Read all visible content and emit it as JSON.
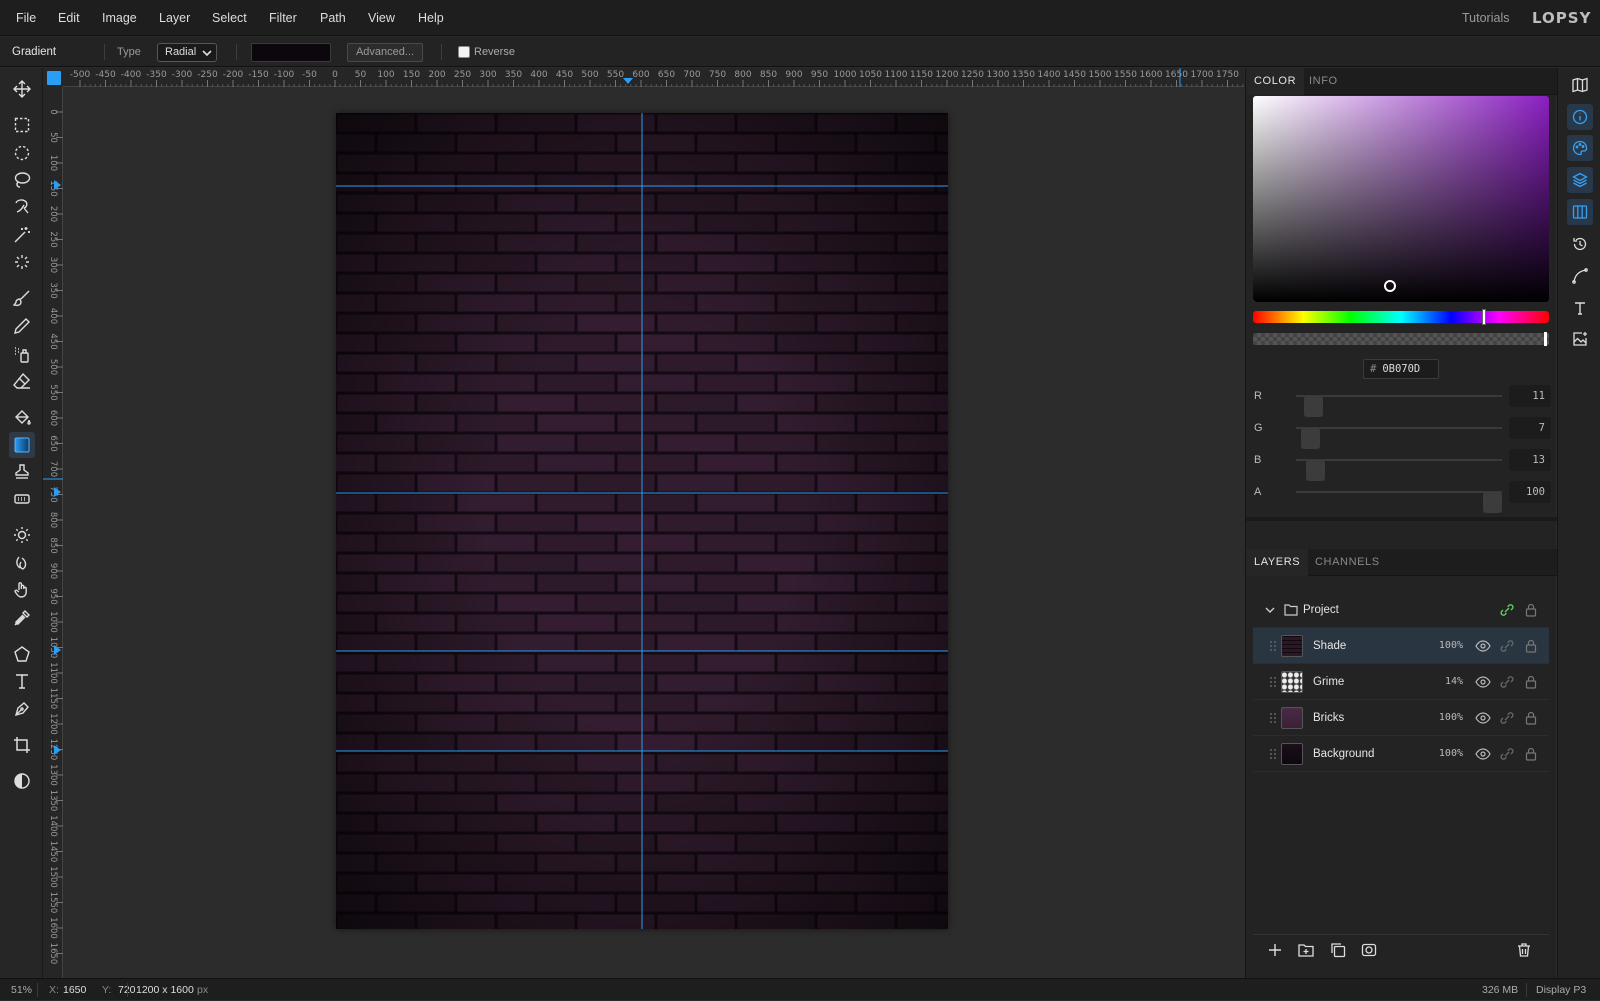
{
  "menubar": {
    "items": [
      "File",
      "Edit",
      "Image",
      "Layer",
      "Select",
      "Filter",
      "Path",
      "View",
      "Help"
    ],
    "tutorials": "Tutorials",
    "logo": "LOPSY"
  },
  "options": {
    "tool_title": "Gradient",
    "type_label": "Type",
    "type_value": "Radial",
    "advanced_label": "Advanced...",
    "reverse_label": "Reverse",
    "reverse_checked": false
  },
  "tools": [
    "move-icon",
    "rect-select-icon",
    "ellipse-select-icon",
    "lasso-icon",
    "quick-select-icon",
    "magic-wand-icon",
    "object-select-icon",
    "brush-icon",
    "pencil-icon",
    "spray-icon",
    "eraser-icon",
    "paint-bucket-icon",
    "gradient-icon",
    "clone-stamp-icon",
    "patch-icon",
    "dodge-icon",
    "burn-icon",
    "smudge-hand-icon",
    "eyedropper-icon",
    "shape-icon",
    "text-icon",
    "pen-icon",
    "crop-icon",
    "contrast-icon"
  ],
  "active_tool": "gradient-icon",
  "rulers": {
    "top_labels": [
      "-500",
      "-450",
      "-400",
      "-350",
      "-300",
      "-250",
      "-200",
      "-150",
      "-100",
      "-50",
      "0",
      "50",
      "100",
      "150",
      "200",
      "250",
      "300",
      "350",
      "400",
      "450",
      "500",
      "550",
      "600",
      "650",
      "700",
      "750",
      "800",
      "850",
      "900",
      "950",
      "1000",
      "1050",
      "1100",
      "1150",
      "1200",
      "1250",
      "1300",
      "1350",
      "1400",
      "1450",
      "1500",
      "1550",
      "1600",
      "1650",
      "1700",
      "1750"
    ],
    "left_labels": [
      "0",
      "50",
      "100",
      "150",
      "200",
      "250",
      "300",
      "350",
      "400",
      "450",
      "500",
      "550",
      "600",
      "650",
      "700",
      "750",
      "800",
      "850",
      "900",
      "950",
      "1000",
      "1050",
      "1100",
      "1150",
      "1200",
      "1250",
      "1300",
      "1350",
      "1400",
      "1450",
      "1500",
      "1550",
      "1600",
      "1650"
    ]
  },
  "canvas": {
    "document_fill": "#281624",
    "brick_fill": "#2e1a2b",
    "mortar_color": "#140a13",
    "guide_color": "#2a9df4"
  },
  "color_panel": {
    "tabs": [
      "COLOR",
      "INFO"
    ],
    "active_tab": "COLOR",
    "hex_prefix": "#",
    "hex": "0B070D",
    "hue_color": "#8a1fc0",
    "channels": [
      {
        "label": "R",
        "value": "11",
        "fraction": 0.043
      },
      {
        "label": "G",
        "value": "7",
        "fraction": 0.027
      },
      {
        "label": "B",
        "value": "13",
        "fraction": 0.051
      },
      {
        "label": "A",
        "value": "100",
        "fraction": 1.0
      }
    ]
  },
  "layers_panel": {
    "tabs": [
      "LAYERS",
      "CHANNELS"
    ],
    "active_tab": "LAYERS",
    "group_name": "Project",
    "layers": [
      {
        "name": "Shade",
        "opacity": "100%",
        "selected": true
      },
      {
        "name": "Grime",
        "opacity": "14%",
        "selected": false
      },
      {
        "name": "Bricks",
        "opacity": "100%",
        "selected": false
      },
      {
        "name": "Background",
        "opacity": "100%",
        "selected": false
      }
    ]
  },
  "status": {
    "zoom": "51%",
    "x_label": "X:",
    "x": "1650",
    "y_label": "Y:",
    "y": "720",
    "doc_size": "1200 x 1600",
    "doc_unit": "px",
    "memory": "326 MB",
    "color_profile": "Display P3"
  }
}
